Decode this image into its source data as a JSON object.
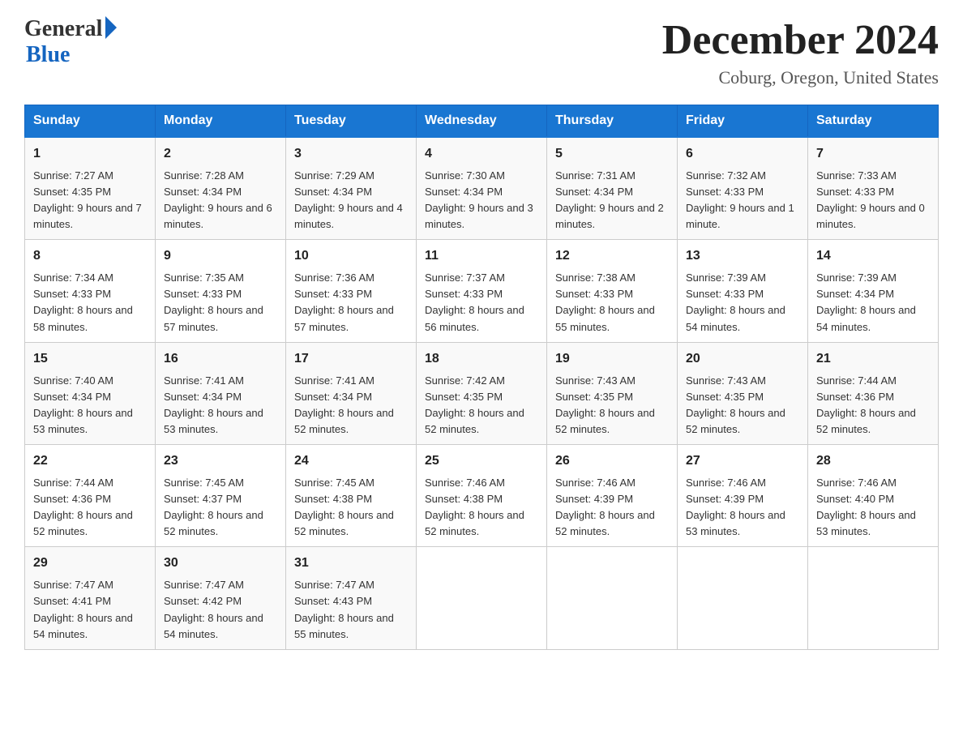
{
  "header": {
    "logo_general": "General",
    "logo_blue": "Blue",
    "month_title": "December 2024",
    "location": "Coburg, Oregon, United States"
  },
  "days_of_week": [
    "Sunday",
    "Monday",
    "Tuesday",
    "Wednesday",
    "Thursday",
    "Friday",
    "Saturday"
  ],
  "weeks": [
    [
      {
        "num": "1",
        "sunrise": "7:27 AM",
        "sunset": "4:35 PM",
        "daylight": "9 hours and 7 minutes."
      },
      {
        "num": "2",
        "sunrise": "7:28 AM",
        "sunset": "4:34 PM",
        "daylight": "9 hours and 6 minutes."
      },
      {
        "num": "3",
        "sunrise": "7:29 AM",
        "sunset": "4:34 PM",
        "daylight": "9 hours and 4 minutes."
      },
      {
        "num": "4",
        "sunrise": "7:30 AM",
        "sunset": "4:34 PM",
        "daylight": "9 hours and 3 minutes."
      },
      {
        "num": "5",
        "sunrise": "7:31 AM",
        "sunset": "4:34 PM",
        "daylight": "9 hours and 2 minutes."
      },
      {
        "num": "6",
        "sunrise": "7:32 AM",
        "sunset": "4:33 PM",
        "daylight": "9 hours and 1 minute."
      },
      {
        "num": "7",
        "sunrise": "7:33 AM",
        "sunset": "4:33 PM",
        "daylight": "9 hours and 0 minutes."
      }
    ],
    [
      {
        "num": "8",
        "sunrise": "7:34 AM",
        "sunset": "4:33 PM",
        "daylight": "8 hours and 58 minutes."
      },
      {
        "num": "9",
        "sunrise": "7:35 AM",
        "sunset": "4:33 PM",
        "daylight": "8 hours and 57 minutes."
      },
      {
        "num": "10",
        "sunrise": "7:36 AM",
        "sunset": "4:33 PM",
        "daylight": "8 hours and 57 minutes."
      },
      {
        "num": "11",
        "sunrise": "7:37 AM",
        "sunset": "4:33 PM",
        "daylight": "8 hours and 56 minutes."
      },
      {
        "num": "12",
        "sunrise": "7:38 AM",
        "sunset": "4:33 PM",
        "daylight": "8 hours and 55 minutes."
      },
      {
        "num": "13",
        "sunrise": "7:39 AM",
        "sunset": "4:33 PM",
        "daylight": "8 hours and 54 minutes."
      },
      {
        "num": "14",
        "sunrise": "7:39 AM",
        "sunset": "4:34 PM",
        "daylight": "8 hours and 54 minutes."
      }
    ],
    [
      {
        "num": "15",
        "sunrise": "7:40 AM",
        "sunset": "4:34 PM",
        "daylight": "8 hours and 53 minutes."
      },
      {
        "num": "16",
        "sunrise": "7:41 AM",
        "sunset": "4:34 PM",
        "daylight": "8 hours and 53 minutes."
      },
      {
        "num": "17",
        "sunrise": "7:41 AM",
        "sunset": "4:34 PM",
        "daylight": "8 hours and 52 minutes."
      },
      {
        "num": "18",
        "sunrise": "7:42 AM",
        "sunset": "4:35 PM",
        "daylight": "8 hours and 52 minutes."
      },
      {
        "num": "19",
        "sunrise": "7:43 AM",
        "sunset": "4:35 PM",
        "daylight": "8 hours and 52 minutes."
      },
      {
        "num": "20",
        "sunrise": "7:43 AM",
        "sunset": "4:35 PM",
        "daylight": "8 hours and 52 minutes."
      },
      {
        "num": "21",
        "sunrise": "7:44 AM",
        "sunset": "4:36 PM",
        "daylight": "8 hours and 52 minutes."
      }
    ],
    [
      {
        "num": "22",
        "sunrise": "7:44 AM",
        "sunset": "4:36 PM",
        "daylight": "8 hours and 52 minutes."
      },
      {
        "num": "23",
        "sunrise": "7:45 AM",
        "sunset": "4:37 PM",
        "daylight": "8 hours and 52 minutes."
      },
      {
        "num": "24",
        "sunrise": "7:45 AM",
        "sunset": "4:38 PM",
        "daylight": "8 hours and 52 minutes."
      },
      {
        "num": "25",
        "sunrise": "7:46 AM",
        "sunset": "4:38 PM",
        "daylight": "8 hours and 52 minutes."
      },
      {
        "num": "26",
        "sunrise": "7:46 AM",
        "sunset": "4:39 PM",
        "daylight": "8 hours and 52 minutes."
      },
      {
        "num": "27",
        "sunrise": "7:46 AM",
        "sunset": "4:39 PM",
        "daylight": "8 hours and 53 minutes."
      },
      {
        "num": "28",
        "sunrise": "7:46 AM",
        "sunset": "4:40 PM",
        "daylight": "8 hours and 53 minutes."
      }
    ],
    [
      {
        "num": "29",
        "sunrise": "7:47 AM",
        "sunset": "4:41 PM",
        "daylight": "8 hours and 54 minutes."
      },
      {
        "num": "30",
        "sunrise": "7:47 AM",
        "sunset": "4:42 PM",
        "daylight": "8 hours and 54 minutes."
      },
      {
        "num": "31",
        "sunrise": "7:47 AM",
        "sunset": "4:43 PM",
        "daylight": "8 hours and 55 minutes."
      },
      null,
      null,
      null,
      null
    ]
  ],
  "labels": {
    "sunrise": "Sunrise:",
    "sunset": "Sunset:",
    "daylight": "Daylight:"
  }
}
